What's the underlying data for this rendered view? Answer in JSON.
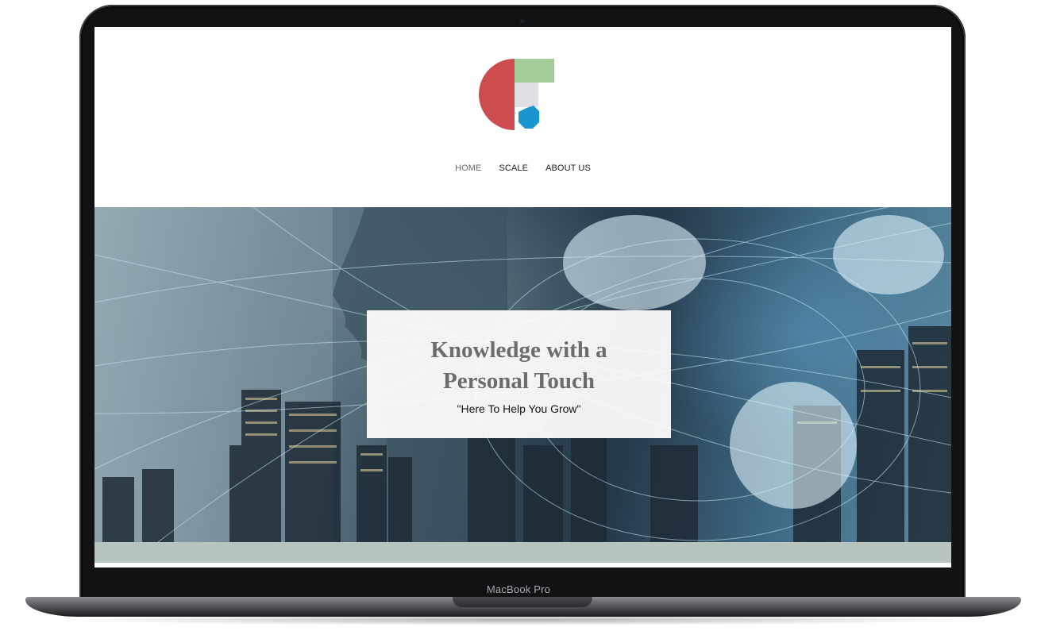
{
  "device": {
    "label": "MacBook Pro"
  },
  "site": {
    "logo_icon": "geometric-logo-icon",
    "colors": {
      "red": "#cd4d4f",
      "green": "#a3cc99",
      "gray": "#dfe0e6",
      "blue": "#1b97cf"
    }
  },
  "nav": {
    "items": [
      {
        "label": "HOME",
        "active": true
      },
      {
        "label": "SCALE",
        "active": false
      },
      {
        "label": "ABOUT US",
        "active": false
      }
    ]
  },
  "hero": {
    "title_line1": "Knowledge with a",
    "title_line2": "Personal Touch",
    "subtitle": "\"Here To Help You Grow\""
  },
  "footer_strip": {
    "color": "#b7c3bd"
  }
}
